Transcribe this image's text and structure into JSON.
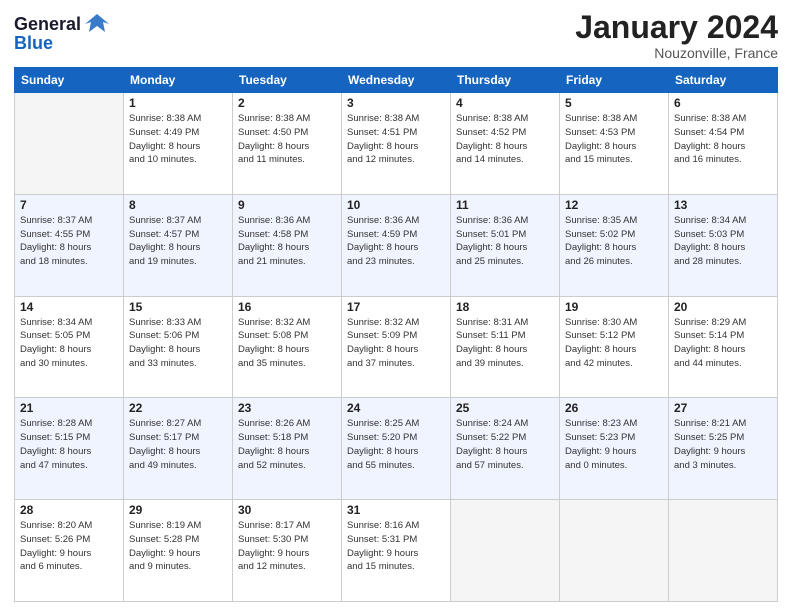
{
  "logo": {
    "text_general": "General",
    "text_blue": "Blue"
  },
  "header": {
    "month": "January 2024",
    "location": "Nouzonville, France"
  },
  "weekdays": [
    "Sunday",
    "Monday",
    "Tuesday",
    "Wednesday",
    "Thursday",
    "Friday",
    "Saturday"
  ],
  "weeks": [
    [
      {
        "day": "",
        "info": ""
      },
      {
        "day": "1",
        "info": "Sunrise: 8:38 AM\nSunset: 4:49 PM\nDaylight: 8 hours\nand 10 minutes."
      },
      {
        "day": "2",
        "info": "Sunrise: 8:38 AM\nSunset: 4:50 PM\nDaylight: 8 hours\nand 11 minutes."
      },
      {
        "day": "3",
        "info": "Sunrise: 8:38 AM\nSunset: 4:51 PM\nDaylight: 8 hours\nand 12 minutes."
      },
      {
        "day": "4",
        "info": "Sunrise: 8:38 AM\nSunset: 4:52 PM\nDaylight: 8 hours\nand 14 minutes."
      },
      {
        "day": "5",
        "info": "Sunrise: 8:38 AM\nSunset: 4:53 PM\nDaylight: 8 hours\nand 15 minutes."
      },
      {
        "day": "6",
        "info": "Sunrise: 8:38 AM\nSunset: 4:54 PM\nDaylight: 8 hours\nand 16 minutes."
      }
    ],
    [
      {
        "day": "7",
        "info": "Sunrise: 8:37 AM\nSunset: 4:55 PM\nDaylight: 8 hours\nand 18 minutes."
      },
      {
        "day": "8",
        "info": "Sunrise: 8:37 AM\nSunset: 4:57 PM\nDaylight: 8 hours\nand 19 minutes."
      },
      {
        "day": "9",
        "info": "Sunrise: 8:36 AM\nSunset: 4:58 PM\nDaylight: 8 hours\nand 21 minutes."
      },
      {
        "day": "10",
        "info": "Sunrise: 8:36 AM\nSunset: 4:59 PM\nDaylight: 8 hours\nand 23 minutes."
      },
      {
        "day": "11",
        "info": "Sunrise: 8:36 AM\nSunset: 5:01 PM\nDaylight: 8 hours\nand 25 minutes."
      },
      {
        "day": "12",
        "info": "Sunrise: 8:35 AM\nSunset: 5:02 PM\nDaylight: 8 hours\nand 26 minutes."
      },
      {
        "day": "13",
        "info": "Sunrise: 8:34 AM\nSunset: 5:03 PM\nDaylight: 8 hours\nand 28 minutes."
      }
    ],
    [
      {
        "day": "14",
        "info": "Sunrise: 8:34 AM\nSunset: 5:05 PM\nDaylight: 8 hours\nand 30 minutes."
      },
      {
        "day": "15",
        "info": "Sunrise: 8:33 AM\nSunset: 5:06 PM\nDaylight: 8 hours\nand 33 minutes."
      },
      {
        "day": "16",
        "info": "Sunrise: 8:32 AM\nSunset: 5:08 PM\nDaylight: 8 hours\nand 35 minutes."
      },
      {
        "day": "17",
        "info": "Sunrise: 8:32 AM\nSunset: 5:09 PM\nDaylight: 8 hours\nand 37 minutes."
      },
      {
        "day": "18",
        "info": "Sunrise: 8:31 AM\nSunset: 5:11 PM\nDaylight: 8 hours\nand 39 minutes."
      },
      {
        "day": "19",
        "info": "Sunrise: 8:30 AM\nSunset: 5:12 PM\nDaylight: 8 hours\nand 42 minutes."
      },
      {
        "day": "20",
        "info": "Sunrise: 8:29 AM\nSunset: 5:14 PM\nDaylight: 8 hours\nand 44 minutes."
      }
    ],
    [
      {
        "day": "21",
        "info": "Sunrise: 8:28 AM\nSunset: 5:15 PM\nDaylight: 8 hours\nand 47 minutes."
      },
      {
        "day": "22",
        "info": "Sunrise: 8:27 AM\nSunset: 5:17 PM\nDaylight: 8 hours\nand 49 minutes."
      },
      {
        "day": "23",
        "info": "Sunrise: 8:26 AM\nSunset: 5:18 PM\nDaylight: 8 hours\nand 52 minutes."
      },
      {
        "day": "24",
        "info": "Sunrise: 8:25 AM\nSunset: 5:20 PM\nDaylight: 8 hours\nand 55 minutes."
      },
      {
        "day": "25",
        "info": "Sunrise: 8:24 AM\nSunset: 5:22 PM\nDaylight: 8 hours\nand 57 minutes."
      },
      {
        "day": "26",
        "info": "Sunrise: 8:23 AM\nSunset: 5:23 PM\nDaylight: 9 hours\nand 0 minutes."
      },
      {
        "day": "27",
        "info": "Sunrise: 8:21 AM\nSunset: 5:25 PM\nDaylight: 9 hours\nand 3 minutes."
      }
    ],
    [
      {
        "day": "28",
        "info": "Sunrise: 8:20 AM\nSunset: 5:26 PM\nDaylight: 9 hours\nand 6 minutes."
      },
      {
        "day": "29",
        "info": "Sunrise: 8:19 AM\nSunset: 5:28 PM\nDaylight: 9 hours\nand 9 minutes."
      },
      {
        "day": "30",
        "info": "Sunrise: 8:17 AM\nSunset: 5:30 PM\nDaylight: 9 hours\nand 12 minutes."
      },
      {
        "day": "31",
        "info": "Sunrise: 8:16 AM\nSunset: 5:31 PM\nDaylight: 9 hours\nand 15 minutes."
      },
      {
        "day": "",
        "info": ""
      },
      {
        "day": "",
        "info": ""
      },
      {
        "day": "",
        "info": ""
      }
    ]
  ]
}
